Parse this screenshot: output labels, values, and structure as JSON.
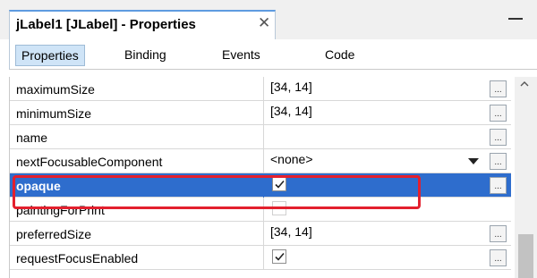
{
  "window": {
    "title": "jLabel1 [JLabel] - Properties",
    "close_glyph": "✕"
  },
  "tabs": [
    {
      "label": "Properties",
      "active": true
    },
    {
      "label": "Binding",
      "active": false
    },
    {
      "label": "Events",
      "active": false
    },
    {
      "label": "Code",
      "active": false
    }
  ],
  "properties": [
    {
      "name": "maximumSize",
      "value": "[34, 14]",
      "type": "text",
      "has_ellipsis": true
    },
    {
      "name": "minimumSize",
      "value": "[34, 14]",
      "type": "text",
      "has_ellipsis": true
    },
    {
      "name": "name",
      "value": "",
      "type": "text",
      "has_ellipsis": true
    },
    {
      "name": "nextFocusableComponent",
      "value": "<none>",
      "type": "dropdown",
      "has_ellipsis": true
    },
    {
      "name": "opaque",
      "value": "true",
      "type": "checkbox",
      "selected": true,
      "has_ellipsis": true
    },
    {
      "name": "paintingForPrint",
      "value": "false",
      "type": "checkbox-disabled",
      "has_ellipsis": false
    },
    {
      "name": "preferredSize",
      "value": "[34, 14]",
      "type": "text",
      "has_ellipsis": true
    },
    {
      "name": "requestFocusEnabled",
      "value": "true",
      "type": "checkbox",
      "has_ellipsis": true
    }
  ],
  "ellipsis_label": "...",
  "colors": {
    "selection": "#2e6dcd",
    "highlight_border": "#e3202e",
    "active_tab": "#cfe4f7"
  },
  "icons": {
    "close": "close-icon",
    "minimize": "minimize-icon",
    "dropdown": "dropdown-arrow-icon",
    "scroll_up": "scroll-up-icon",
    "checkbox": "checkmark-icon"
  }
}
